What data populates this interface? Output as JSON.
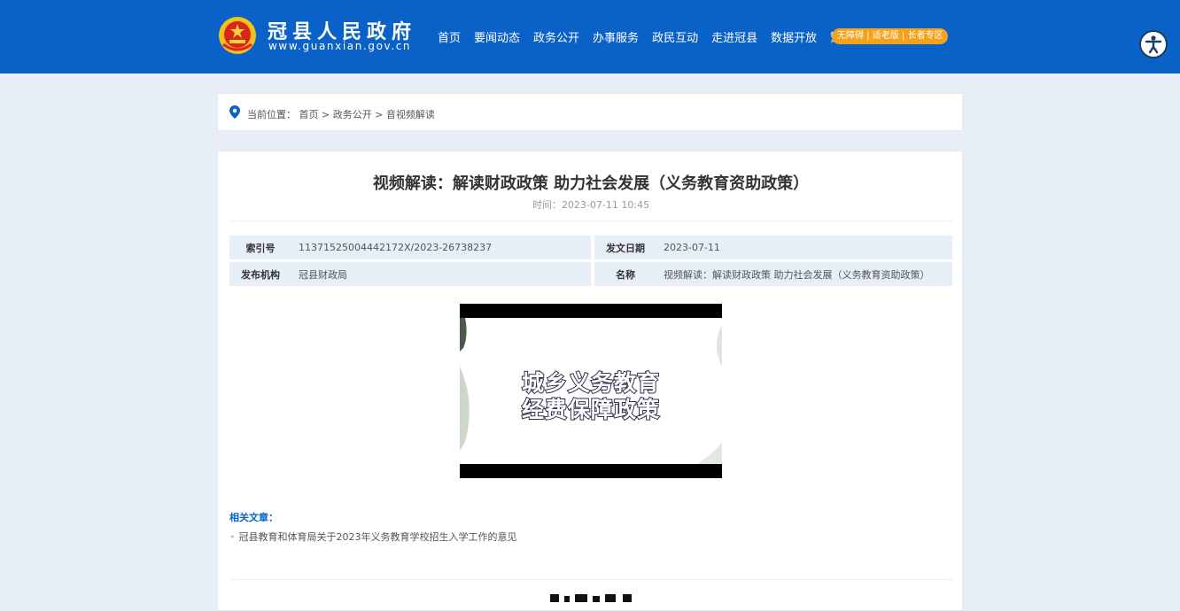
{
  "header": {
    "site_name": "冠县人民政府",
    "site_url": "www.guanxian.gov.cn",
    "nav": [
      "首页",
      "要闻动态",
      "政务公开",
      "办事服务",
      "政民互动",
      "走进冠县",
      "数据开放"
    ],
    "traditional_toggle": "繁",
    "access_pill": "无障碍 | 适老版 | 长者专区",
    "colors": {
      "bar": "#0a62c8",
      "pill": "#f5a21b"
    },
    "icons": {
      "emblem": "national-emblem-icon",
      "accessibility": "accessibility-icon"
    }
  },
  "breadcrumb": {
    "icon": "location-pin-icon",
    "label": "当前位置：",
    "path": "首页 > 政务公开 > 音视频解读"
  },
  "article": {
    "title": "视频解读：解读财政政策 助力社会发展（义务教育资助政策）",
    "time_label": "时间：",
    "time_value": "2023-07-11 10:45",
    "meta": {
      "index_label": "索引号",
      "index_value": "11371525004442172X/2023-26738237",
      "date_label": "发文日期",
      "date_value": "2023-07-11",
      "org_label": "发布机构",
      "org_value": "冠县财政局",
      "name_label": "名称",
      "name_value": "视频解读：解读财政政策 助力社会发展（义务教育资助政策）"
    },
    "video": {
      "line1": "城乡义务教育",
      "line2": "经费保障政策"
    },
    "related": {
      "title": "相关文章：",
      "items": [
        "冠县教育和体育局关于2023年义务教育学校招生入学工作的意见"
      ]
    }
  }
}
